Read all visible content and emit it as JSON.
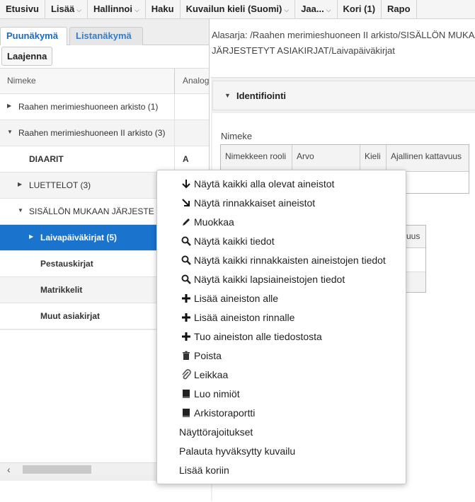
{
  "nav": {
    "items": [
      {
        "label": "Etusivu",
        "caret": false
      },
      {
        "label": "Lisää",
        "caret": true
      },
      {
        "label": "Hallinnoi",
        "caret": true
      },
      {
        "label": "Haku",
        "caret": false
      },
      {
        "label": "Kuvailun kieli (Suomi)",
        "caret": true
      },
      {
        "label": "Jaa...",
        "caret": true
      },
      {
        "label": "Kori (1)",
        "caret": false
      },
      {
        "label": "Rapo",
        "caret": false
      }
    ]
  },
  "left": {
    "tabs": {
      "tree": "Puunäkymä",
      "list": "Listanäkymä"
    },
    "expand_button": "Laajenna",
    "grid": {
      "col1": "Nimeke",
      "col2": "Analog",
      "rows": [
        {
          "label": "Raahen merimieshuoneen arkisto (1)",
          "arrow": "right",
          "level": 0,
          "bold": false,
          "value": "",
          "alt": false,
          "selected": false
        },
        {
          "label": "Raahen merimieshuoneen II arkisto (3)",
          "arrow": "down",
          "level": 0,
          "bold": false,
          "value": "",
          "alt": true,
          "selected": false
        },
        {
          "label": "DIAARIT",
          "arrow": "",
          "level": 1,
          "bold": true,
          "value": "A",
          "alt": false,
          "selected": false
        },
        {
          "label": "LUETTELOT (3)",
          "arrow": "right",
          "level": 1,
          "bold": false,
          "value": "",
          "alt": true,
          "selected": false
        },
        {
          "label": "SISÄLLÖN MUKAAN JÄRJESTE",
          "arrow": "down",
          "level": 1,
          "bold": false,
          "value": "",
          "alt": false,
          "selected": false
        },
        {
          "label": "Laivapäiväkirjat (5)",
          "arrow": "right",
          "level": 2,
          "bold": true,
          "value": "",
          "alt": false,
          "selected": true
        },
        {
          "label": "Pestauskirjat",
          "arrow": "",
          "level": 2,
          "bold": true,
          "value": "",
          "alt": false,
          "selected": false
        },
        {
          "label": "Matrikkelit",
          "arrow": "",
          "level": 2,
          "bold": true,
          "value": "",
          "alt": true,
          "selected": false
        },
        {
          "label": "Muut asiakirjat",
          "arrow": "",
          "level": 2,
          "bold": true,
          "value": "",
          "alt": false,
          "selected": false
        }
      ]
    }
  },
  "right": {
    "path_line1": "Alasarja: /Raahen merimieshuoneen II arkisto/SISÄLLÖN MUKAAN",
    "path_line2": "JÄRJESTETYT ASIAKIRJAT/Laivapäiväkirjat",
    "section_title": "Identifiointi",
    "nimeke_label": "Nimeke",
    "table_headers": [
      "Nimekkeen rooli",
      "Arvo",
      "Kieli",
      "Ajallinen kattavuus"
    ],
    "table2_header_fragment": "uus"
  },
  "context_menu": {
    "items": [
      {
        "label": "Näytä kaikki alla olevat aineistot",
        "icon": "arrow-down-icon"
      },
      {
        "label": "Näytä rinnakkaiset aineistot",
        "icon": "arrow-diagonal-icon"
      },
      {
        "label": "Muokkaa",
        "icon": "pencil-icon"
      },
      {
        "label": "Näytä kaikki tiedot",
        "icon": "search-icon"
      },
      {
        "label": "Näytä kaikki rinnakkaisten aineistojen tiedot",
        "icon": "search-icon"
      },
      {
        "label": "Näytä kaikki lapsiaineistojen tiedot",
        "icon": "search-icon"
      },
      {
        "label": "Lisää aineiston alle",
        "icon": "plus-icon"
      },
      {
        "label": "Lisää aineiston rinnalle",
        "icon": "plus-icon"
      },
      {
        "label": "Tuo aineiston alle tiedostosta",
        "icon": "plus-icon"
      },
      {
        "label": "Poista",
        "icon": "trash-icon"
      },
      {
        "label": "Leikkaa",
        "icon": "paperclip-icon"
      },
      {
        "label": "Luo nimiöt",
        "icon": "book-icon"
      },
      {
        "label": "Arkistoraportti",
        "icon": "book-icon"
      },
      {
        "label": "Näyttörajoitukset",
        "icon": ""
      },
      {
        "label": "Palauta hyväksytty kuvailu",
        "icon": ""
      },
      {
        "label": "Lisää koriin",
        "icon": ""
      }
    ]
  },
  "colors": {
    "selected_row": "#1a73cc",
    "tab_active_text": "#1f6bb8"
  }
}
